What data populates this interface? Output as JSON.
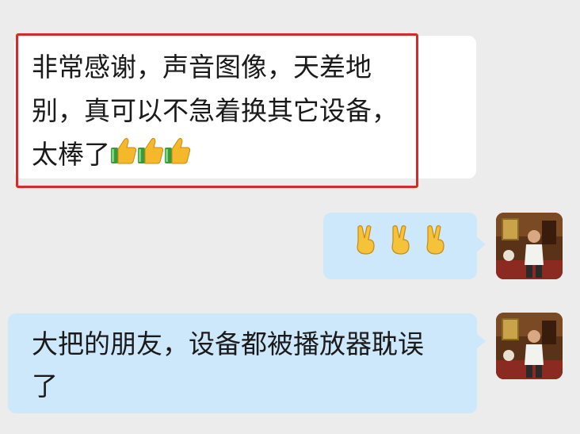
{
  "messages": [
    {
      "side": "left",
      "lines": [
        "非常感谢，声音图像，天差地",
        "别，真可以不急着换其它设备，",
        "太棒了"
      ],
      "emoji": [
        "thumbs-up-icon",
        "thumbs-up-icon",
        "thumbs-up-icon"
      ],
      "highlight_color": "#d62a2a"
    },
    {
      "side": "right",
      "emoji": [
        "victory-hand-icon",
        "victory-hand-icon",
        "victory-hand-icon"
      ]
    },
    {
      "side": "right",
      "lines": [
        "大把的朋友，设备都被播放器耽误",
        "了"
      ]
    }
  ],
  "colors": {
    "background": "#ececec",
    "incoming_bubble": "#ffffff",
    "outgoing_bubble": "#cde8fb",
    "highlight_border": "#d62a2a"
  }
}
